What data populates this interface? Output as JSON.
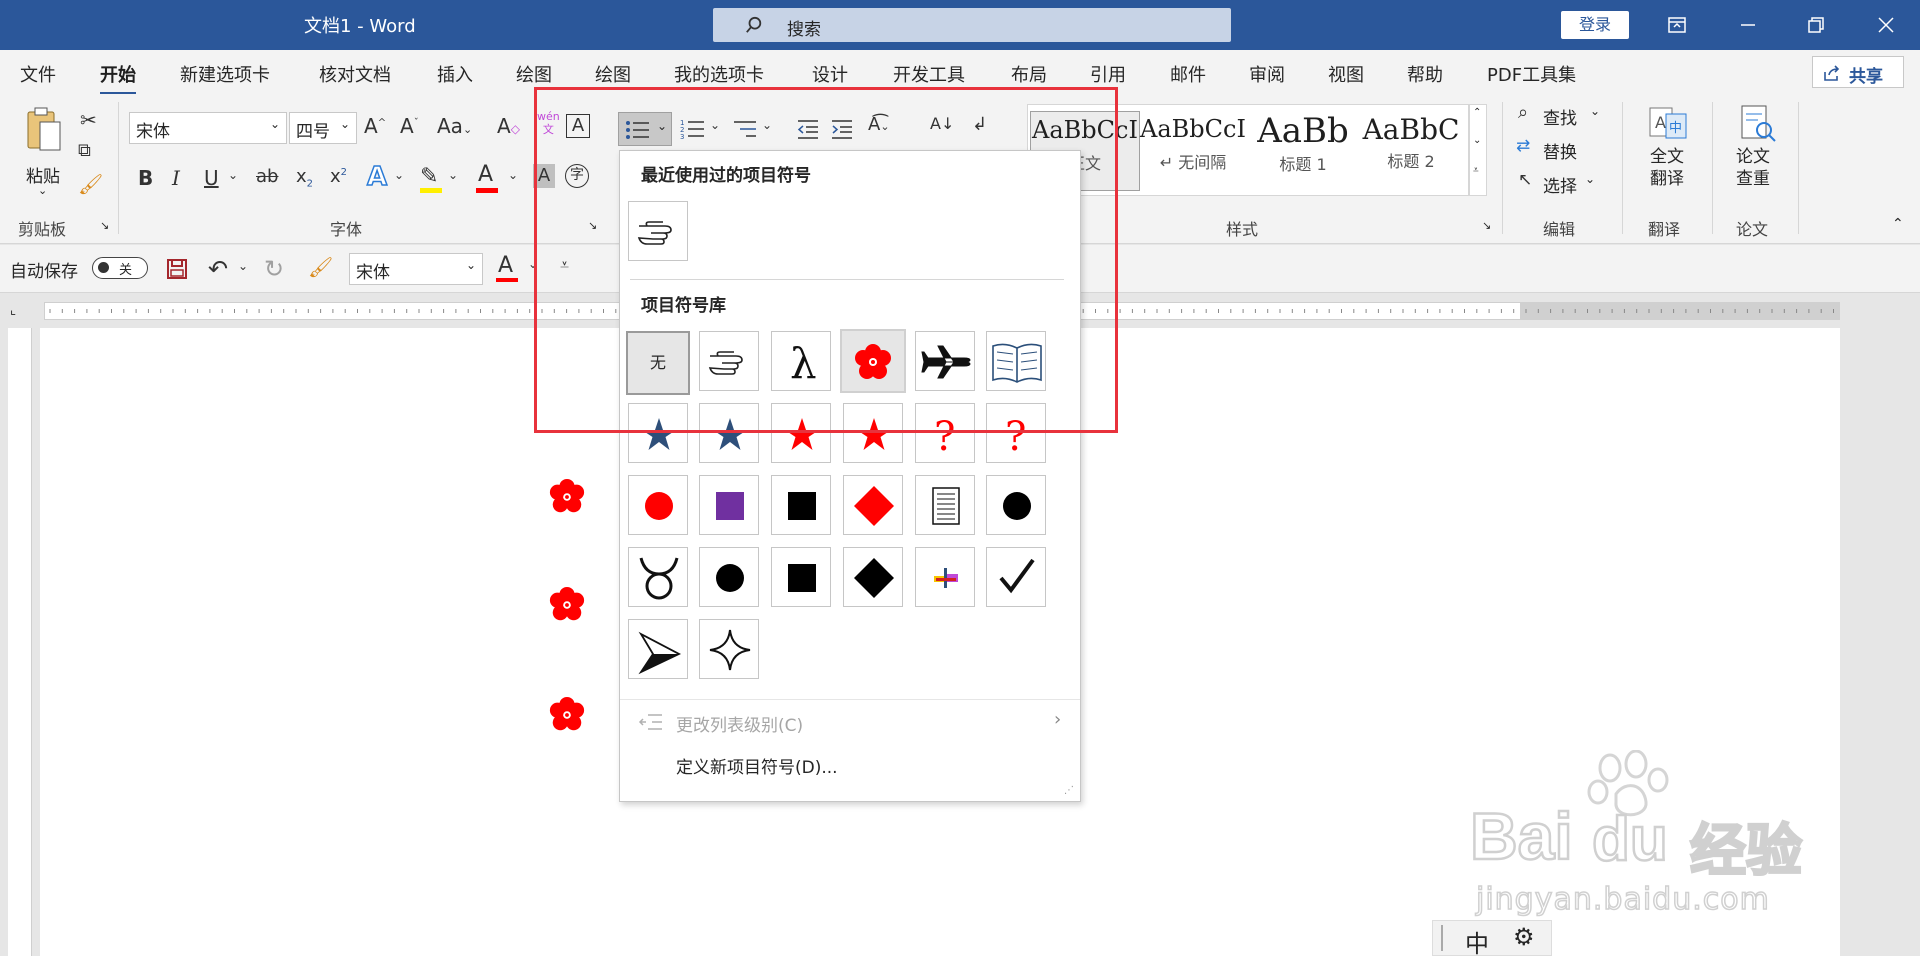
{
  "titlebar": {
    "title": "文档1  -  Word",
    "search_placeholder": "搜索",
    "login_label": "登录"
  },
  "menu": {
    "tabs": [
      "文件",
      "开始",
      "新建选项卡",
      "核对文档",
      "插入",
      "绘图",
      "绘图",
      "我的选项卡",
      "设计",
      "开发工具",
      "布局",
      "引用",
      "邮件",
      "审阅",
      "视图",
      "帮助",
      "PDF工具集"
    ],
    "active_tab": "开始",
    "share_label": "共享"
  },
  "ribbon": {
    "clipboard": {
      "paste_label": "粘贴",
      "group_label": "剪贴板"
    },
    "font": {
      "font_name": "宋体",
      "font_size": "四号",
      "group_label": "字体"
    },
    "styles": {
      "items": [
        {
          "preview": "AaBbCcI",
          "name": "正文"
        },
        {
          "preview": "AaBbCcI",
          "name": "↵ 无间隔"
        },
        {
          "preview": "AaBb",
          "name": "标题 1"
        },
        {
          "preview": "AaBbC",
          "name": "标题 2"
        }
      ],
      "group_label": "样式"
    },
    "editing": {
      "find": "查找",
      "replace": "替换",
      "select": "选择",
      "group_label": "编辑"
    },
    "translate": {
      "button": "全文\n翻译",
      "group_label": "翻译"
    },
    "paper": {
      "button": "论文\n查重",
      "group_label": "论文"
    }
  },
  "qat": {
    "autosave_label": "自动保存",
    "toggle_state": "关",
    "font_name": "宋体"
  },
  "bullet_dropdown": {
    "recent_heading": "最近使用过的项目符号",
    "library_heading": "项目符号库",
    "none_label": "无",
    "change_level": "更改列表级别(C)",
    "define_new": "定义新项目符号(D)..."
  },
  "colors": {
    "titlebar": "#2b579a",
    "bullet_red": "#ff0000",
    "star_blue": "#2e4f7a",
    "highlight_box": "#e8323c"
  },
  "watermark": {
    "brand": "Bai",
    "brand2": "du",
    "cn": "经验",
    "url": "jingyan.baidu.com"
  },
  "ime": {
    "mode": "中"
  }
}
